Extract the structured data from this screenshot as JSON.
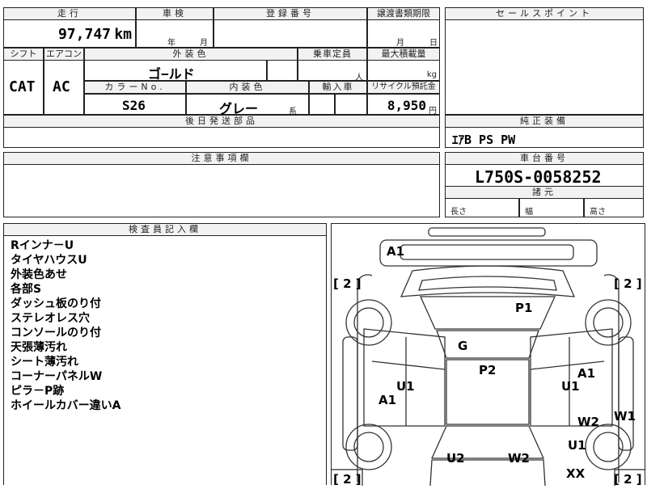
{
  "mileage": {
    "header": "走行",
    "value": "97,747",
    "unit": "km"
  },
  "inspection": {
    "header": "車検",
    "year_unit": "年",
    "month_unit": "月"
  },
  "registration": {
    "header": "登録番号"
  },
  "transfer_doc": {
    "header": "譲渡書類期限",
    "month_unit": "月",
    "day_unit": "日"
  },
  "sales_point": {
    "header": "セールスポイント"
  },
  "shift": {
    "header": "シフト",
    "value": "CAT"
  },
  "aircon": {
    "header": "エアコン",
    "value": "AC"
  },
  "exterior_color": {
    "header": "外装色",
    "value": "ゴ−ルド"
  },
  "capacity": {
    "header": "乗車定員",
    "unit": "人"
  },
  "max_load": {
    "header": "最大積載量",
    "unit": "kg"
  },
  "color_no": {
    "header": "カラーNo.",
    "value": "S26"
  },
  "interior_color": {
    "header": "内装色",
    "value": "グレー",
    "suffix": "系"
  },
  "import": {
    "header": "輸入車"
  },
  "recycle": {
    "header": "リサイクル預託金",
    "value": "8,950",
    "unit": "円"
  },
  "later_parts": {
    "header": "後日発送部品"
  },
  "genuine_equipment": {
    "header": "純正装備",
    "value": "ｴｱB PS PW"
  },
  "caution": {
    "header": "注意事項欄"
  },
  "chassis": {
    "header": "車台番号",
    "value": "L750S-0058252"
  },
  "specs": {
    "header": "諸元",
    "length": "長さ",
    "width": "幅",
    "height": "高さ"
  },
  "inspector": {
    "header": "検査員記入欄",
    "notes": [
      "Rインナ－U",
      "タイヤハウスU",
      "外装色あせ",
      "各部S",
      "ダッシュ板のり付",
      "ステレオレス穴",
      "コンソールのり付",
      "天張薄汚れ",
      "シート薄汚れ",
      "コーナーパネルW",
      "ピラ－P跡",
      "ホイールカバー違いA"
    ]
  },
  "diagram": {
    "tire_marks": [
      "[ 2 ]",
      "[ 2 ]",
      "[ 2 ]",
      "[ 2 ]"
    ],
    "marks": [
      "A1",
      "P1",
      "G",
      "P2",
      "U1",
      "A1",
      "A1",
      "U1",
      "W2",
      "W1",
      "U1",
      "U2",
      "W2",
      "XX"
    ]
  }
}
